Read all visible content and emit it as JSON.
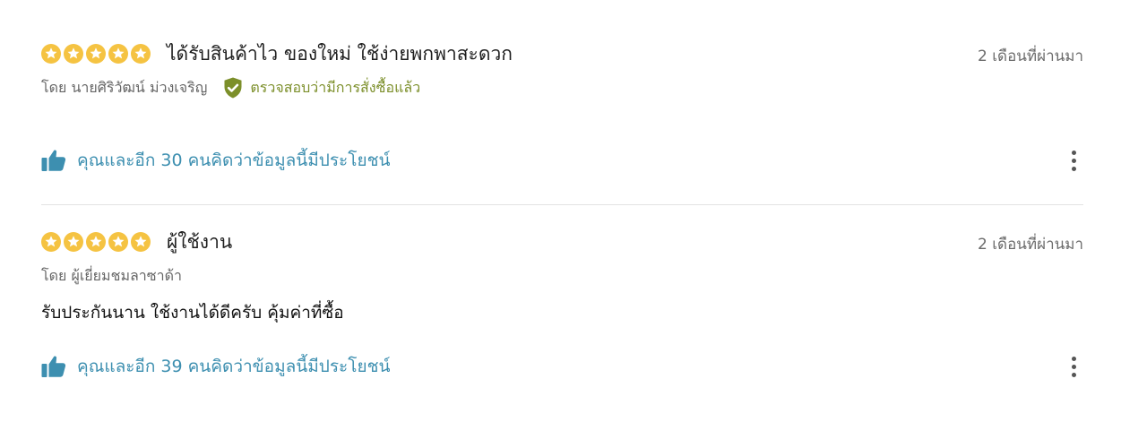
{
  "colors": {
    "star": "#f5c342",
    "verified": "#7c8f2a",
    "helpful": "#3d8fb0",
    "divider": "#e3e3e3"
  },
  "reviews": [
    {
      "rating": 5,
      "title": "ได้รับสินค้าไว ของใหม่ ใช้ง่ายพกพาสะดวก",
      "date": "2 เดือนที่ผ่านมา",
      "author": "โดย นายศิริวัฒน์ ม่วงเจริญ",
      "verified_label": "ตรวจสอบว่ามีการสั่งซื้อแล้ว",
      "body": "",
      "helpful": "คุณและอีก 30 คนคิดว่าข้อมูลนี้มีประโยชน์",
      "icons": {
        "verified": "shield-check-icon",
        "helpful": "thumbs-up-icon",
        "more": "more-vertical-icon"
      }
    },
    {
      "rating": 5,
      "title": "ผู้ใช้งาน",
      "date": "2 เดือนที่ผ่านมา",
      "author": "โดย ผู้เยี่ยมชมลาซาด้า",
      "verified_label": "",
      "body": "รับประกันนาน ใช้งานได้ดีครับ คุ้มค่าที่ซื้อ",
      "helpful": "คุณและอีก 39 คนคิดว่าข้อมูลนี้มีประโยชน์",
      "icons": {
        "helpful": "thumbs-up-icon",
        "more": "more-vertical-icon"
      }
    }
  ]
}
